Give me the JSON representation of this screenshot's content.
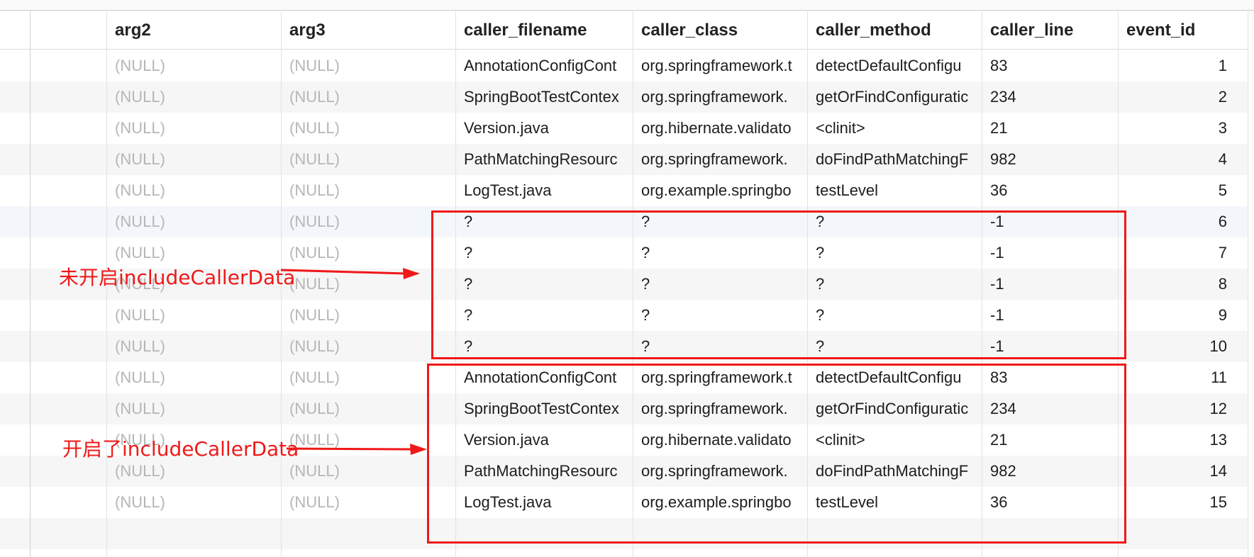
{
  "columns": [
    {
      "key": "arg2",
      "label": "arg2"
    },
    {
      "key": "arg3",
      "label": "arg3"
    },
    {
      "key": "caller_filename",
      "label": "caller_filename"
    },
    {
      "key": "caller_class",
      "label": "caller_class"
    },
    {
      "key": "caller_method",
      "label": "caller_method"
    },
    {
      "key": "caller_line",
      "label": "caller_line"
    },
    {
      "key": "event_id",
      "label": "event_id"
    }
  ],
  "rows": [
    {
      "arg2": "(NULL)",
      "arg3": "(NULL)",
      "caller_filename": "AnnotationConfigCont",
      "caller_class": "org.springframework.t",
      "caller_method": "detectDefaultConfigu",
      "caller_line": "83",
      "event_id": "1"
    },
    {
      "arg2": "(NULL)",
      "arg3": "(NULL)",
      "caller_filename": "SpringBootTestContex",
      "caller_class": "org.springframework.",
      "caller_method": "getOrFindConfiguratic",
      "caller_line": "234",
      "event_id": "2"
    },
    {
      "arg2": "(NULL)",
      "arg3": "(NULL)",
      "caller_filename": "Version.java",
      "caller_class": "org.hibernate.validato",
      "caller_method": "<clinit>",
      "caller_line": "21",
      "event_id": "3"
    },
    {
      "arg2": "(NULL)",
      "arg3": "(NULL)",
      "caller_filename": "PathMatchingResourc",
      "caller_class": "org.springframework.",
      "caller_method": "doFindPathMatchingF",
      "caller_line": "982",
      "event_id": "4"
    },
    {
      "arg2": "(NULL)",
      "arg3": "(NULL)",
      "caller_filename": "LogTest.java",
      "caller_class": "org.example.springbo",
      "caller_method": "testLevel",
      "caller_line": "36",
      "event_id": "5"
    },
    {
      "arg2": "(NULL)",
      "arg3": "(NULL)",
      "caller_filename": "?",
      "caller_class": "?",
      "caller_method": "?",
      "caller_line": "-1",
      "event_id": "6"
    },
    {
      "arg2": "(NULL)",
      "arg3": "(NULL)",
      "caller_filename": "?",
      "caller_class": "?",
      "caller_method": "?",
      "caller_line": "-1",
      "event_id": "7"
    },
    {
      "arg2": "(NULL)",
      "arg3": "(NULL)",
      "caller_filename": "?",
      "caller_class": "?",
      "caller_method": "?",
      "caller_line": "-1",
      "event_id": "8"
    },
    {
      "arg2": "(NULL)",
      "arg3": "(NULL)",
      "caller_filename": "?",
      "caller_class": "?",
      "caller_method": "?",
      "caller_line": "-1",
      "event_id": "9"
    },
    {
      "arg2": "(NULL)",
      "arg3": "(NULL)",
      "caller_filename": "?",
      "caller_class": "?",
      "caller_method": "?",
      "caller_line": "-1",
      "event_id": "10"
    },
    {
      "arg2": "(NULL)",
      "arg3": "(NULL)",
      "caller_filename": "AnnotationConfigCont",
      "caller_class": "org.springframework.t",
      "caller_method": "detectDefaultConfigu",
      "caller_line": "83",
      "event_id": "11"
    },
    {
      "arg2": "(NULL)",
      "arg3": "(NULL)",
      "caller_filename": "SpringBootTestContex",
      "caller_class": "org.springframework.",
      "caller_method": "getOrFindConfiguratic",
      "caller_line": "234",
      "event_id": "12"
    },
    {
      "arg2": "(NULL)",
      "arg3": "(NULL)",
      "caller_filename": "Version.java",
      "caller_class": "org.hibernate.validato",
      "caller_method": "<clinit>",
      "caller_line": "21",
      "event_id": "13"
    },
    {
      "arg2": "(NULL)",
      "arg3": "(NULL)",
      "caller_filename": "PathMatchingResourc",
      "caller_class": "org.springframework.",
      "caller_method": "doFindPathMatchingF",
      "caller_line": "982",
      "event_id": "14"
    },
    {
      "arg2": "(NULL)",
      "arg3": "(NULL)",
      "caller_filename": "LogTest.java",
      "caller_class": "org.example.springbo",
      "caller_method": "testLevel",
      "caller_line": "36",
      "event_id": "15"
    }
  ],
  "annotations": {
    "disabled_label": "未开启includeCallerData",
    "enabled_label": "开启了includeCallerData",
    "color": "#f01818"
  },
  "colors": {
    "null_text": "#b6b6b6",
    "row_alt": "#f6f6f6"
  }
}
